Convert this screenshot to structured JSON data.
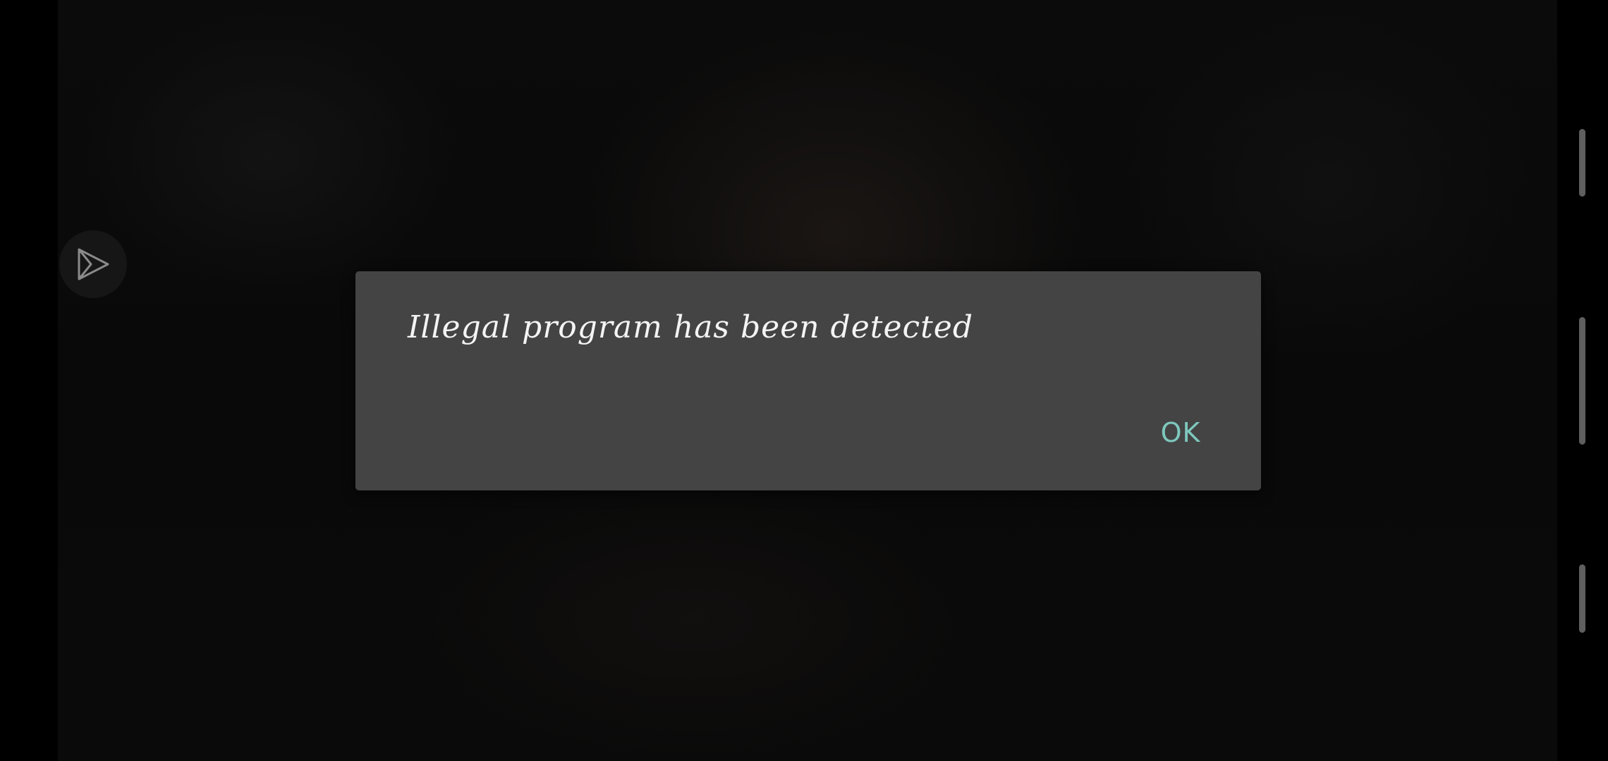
{
  "dialog": {
    "message": "Illegal program has been detected",
    "ok_label": "OK"
  },
  "icons": {
    "floating_button": "send-arrow-icon"
  },
  "colors": {
    "dialog_background": "#444444",
    "dialog_text": "#f4f4f4",
    "ok_accent": "#7ec8bd"
  }
}
